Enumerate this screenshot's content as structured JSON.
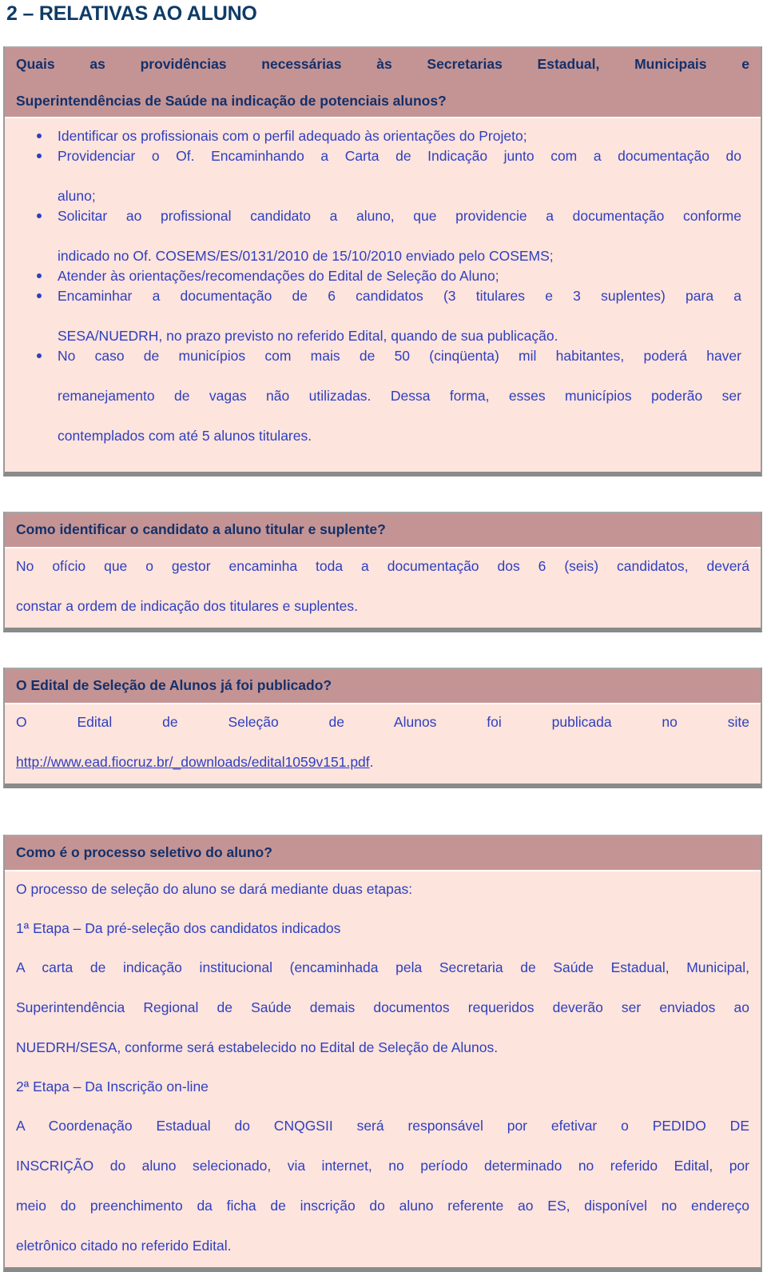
{
  "document": {
    "title": "2 – RELATIVAS AO ALUNO",
    "colors": {
      "title_navy": "#0f3b67",
      "question_bar": "#c49494",
      "answer_background": "#fde4dc",
      "body_text_blue": "#2f3fc0",
      "question_text_navy": "#14306b",
      "border_grey": "#8a8a8a"
    }
  },
  "sections": [
    {
      "question_line1": "Quais as providências necessárias às Secretarias Estadual, Municipais e",
      "question_line2": "Superintendências de Saúde na indicação de potenciais alunos?",
      "bullets": [
        {
          "lines": [
            "Identificar os profissionais com o perfil adequado às orientações do Projeto;"
          ]
        },
        {
          "lines": [
            "Providenciar o Of. Encaminhando a Carta de Indicação junto com a documentação do",
            "aluno;"
          ]
        },
        {
          "lines": [
            "Solicitar ao profissional candidato a aluno, que providencie a documentação conforme",
            "indicado no Of. COSEMS/ES/0131/2010 de 15/10/2010 enviado pelo COSEMS;"
          ]
        },
        {
          "lines": [
            "Atender às orientações/recomendações do Edital de Seleção do Aluno;"
          ]
        },
        {
          "lines": [
            "Encaminhar a documentação de 6 candidatos (3 titulares e 3 suplentes) para a",
            "SESA/NUEDRH, no prazo previsto no referido Edital, quando de sua publicação."
          ]
        },
        {
          "lines": [
            "No caso de municípios com mais de 50 (cinqüenta) mil habitantes, poderá haver",
            "remanejamento de vagas não utilizadas. Dessa forma, esses municípios poderão ser",
            "contemplados com até 5 alunos titulares."
          ]
        }
      ]
    },
    {
      "question_line1": "Como identificar o candidato a aluno titular e suplente?",
      "answer_lines": [
        "No ofício que o gestor encaminha toda a documentação dos 6 (seis) candidatos, deverá",
        "constar a ordem de indicação dos titulares e suplentes."
      ]
    },
    {
      "question_line1": "O Edital de Seleção de Alunos já foi publicado?",
      "answer_prefix_line": "O Edital de Seleção de Alunos foi publicada no site",
      "answer_link_text": "http://www.ead.fiocruz.br/_downloads/edital1059v151.pdf",
      "answer_link_suffix": "."
    },
    {
      "question_line1": "Como é o processo seletivo do aluno?",
      "intro": "O processo de seleção do aluno se dará mediante duas etapas:",
      "stage1_heading": "1ª Etapa – Da pré-seleção dos candidatos indicados",
      "stage1_lines": [
        "A carta de indicação institucional (encaminhada pela Secretaria de Saúde Estadual, Municipal,",
        "Superintendência Regional de Saúde demais documentos requeridos deverão ser enviados ao",
        "NUEDRH/SESA, conforme será estabelecido no Edital de Seleção de Alunos."
      ],
      "stage2_heading": "2ª Etapa – Da Inscrição on-line",
      "stage2_lines": [
        "A Coordenação Estadual do CNQGSII será responsável por efetivar o PEDIDO DE",
        "INSCRIÇÃO do aluno selecionado, via internet, no período determinado no referido Edital, por",
        "meio do preenchimento da ficha de inscrição do aluno referente ao ES, disponível no endereço",
        "eletrônico citado no referido Edital."
      ]
    }
  ]
}
